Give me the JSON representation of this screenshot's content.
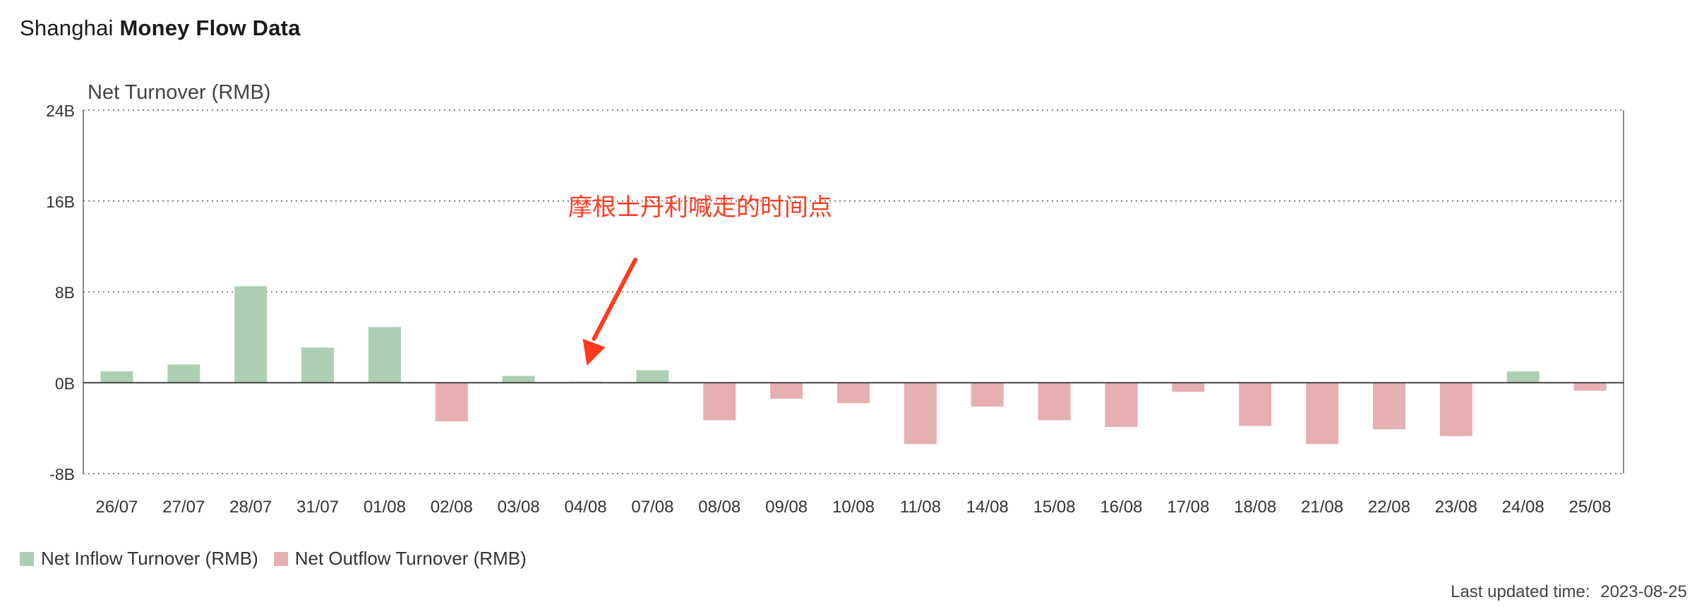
{
  "header": {
    "title_prefix": "Shanghai",
    "title_bold": "Money Flow Data"
  },
  "colors": {
    "inflow": "#adcfb3",
    "outflow": "#e6afb1",
    "annotation": "#ff3b1f",
    "grid": "#555555"
  },
  "chart_data": {
    "type": "bar",
    "ylabel": "Net Turnover (RMB)",
    "ylim": [
      -8,
      24
    ],
    "yticks": [
      -8,
      0,
      8,
      16,
      24
    ],
    "ytick_labels": [
      "-8B",
      "0B",
      "8B",
      "16B",
      "24B"
    ],
    "y_unit": "billion RMB",
    "grid": "dotted horizontal",
    "categories": [
      "26/07",
      "27/07",
      "28/07",
      "31/07",
      "01/08",
      "02/08",
      "03/08",
      "04/08",
      "07/08",
      "08/08",
      "09/08",
      "10/08",
      "11/08",
      "14/08",
      "15/08",
      "16/08",
      "17/08",
      "18/08",
      "21/08",
      "22/08",
      "23/08",
      "24/08",
      "25/08"
    ],
    "values": [
      1.0,
      1.6,
      8.5,
      3.1,
      4.9,
      -3.4,
      0.6,
      0.1,
      1.1,
      -3.3,
      -1.4,
      -1.8,
      -5.4,
      -2.1,
      -3.3,
      -3.9,
      -0.8,
      -3.8,
      -5.4,
      -4.1,
      -4.7,
      1.0,
      -0.7
    ],
    "series": [
      {
        "name": "Net Inflow Turnover (RMB)",
        "color": "#adcfb3"
      },
      {
        "name": "Net Outflow Turnover (RMB)",
        "color": "#e6afb1"
      }
    ],
    "annotation": {
      "text": "摩根士丹利喊走的时间点",
      "target": "04/08"
    },
    "legend_position": "bottom-left"
  },
  "footer": {
    "updated_label": "Last updated time:",
    "updated_value": "2023-08-25"
  }
}
